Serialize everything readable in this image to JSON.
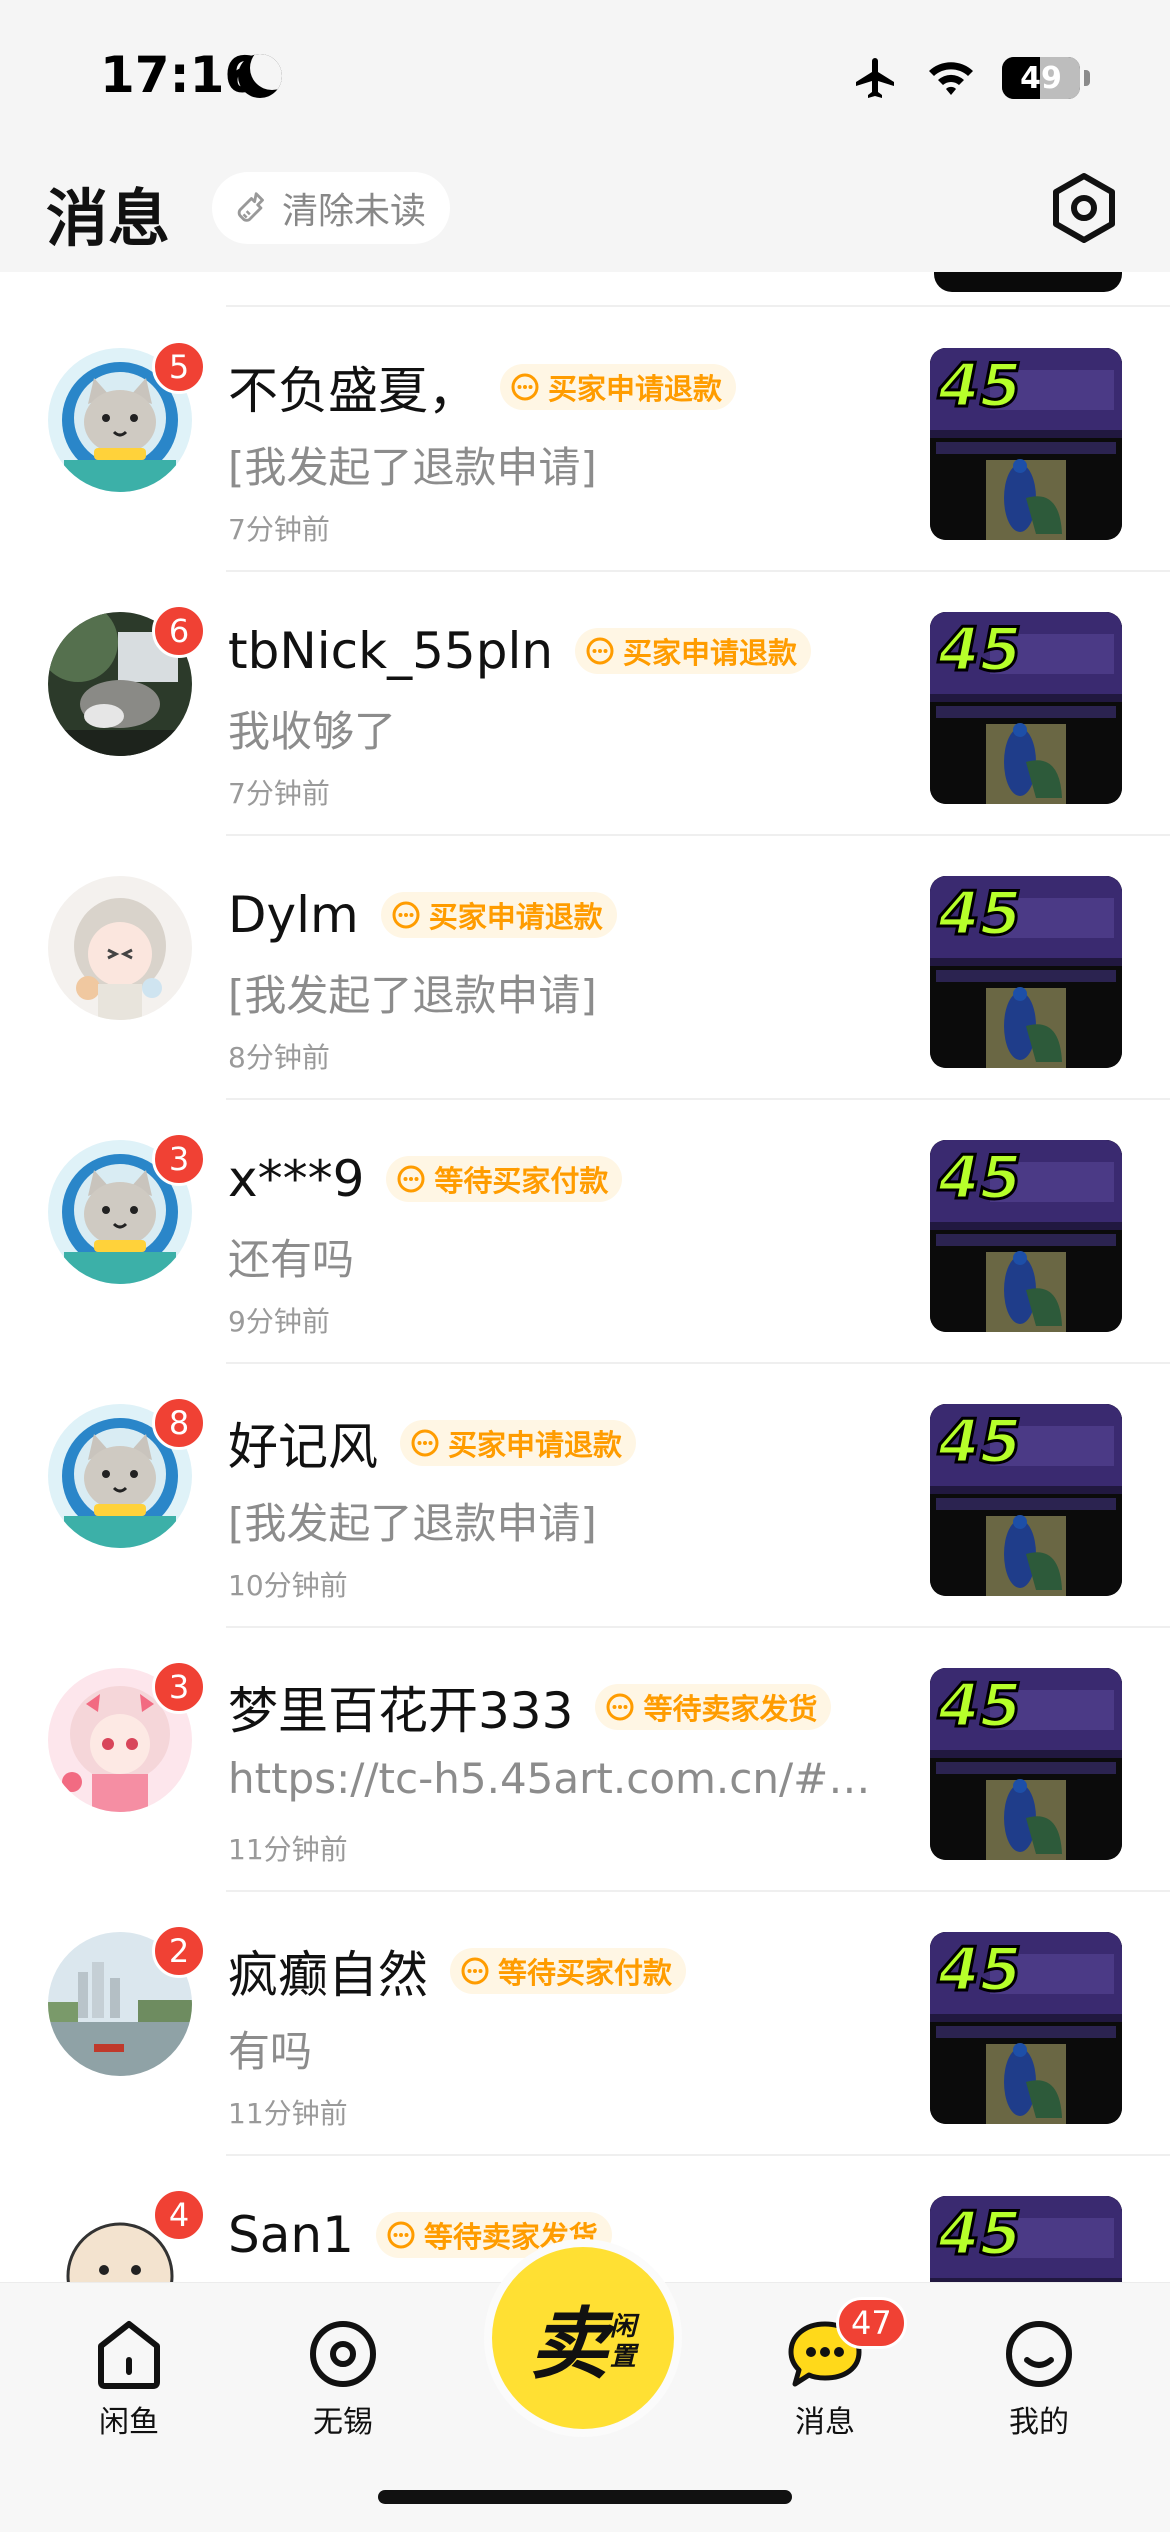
{
  "status_bar": {
    "time": "17:16",
    "battery": "49",
    "battery_level": 0.49
  },
  "header": {
    "title": "消息",
    "clear_unread_label": "清除未读"
  },
  "conversations": [
    {
      "name": "不负盛夏，",
      "badge": "5",
      "status": "买家申请退款",
      "message": "[我发起了退款申请]",
      "time": "7分钟前",
      "avatar": "cat-astronaut"
    },
    {
      "name": "tbNick_55pln",
      "badge": "6",
      "status": "买家申请退款",
      "message": "我收够了",
      "time": "7分钟前",
      "avatar": "photo-dark"
    },
    {
      "name": "Dylm",
      "badge": "",
      "status": "买家申请退款",
      "message": "[我发起了退款申请]",
      "time": "8分钟前",
      "avatar": "anime-girl-light"
    },
    {
      "name": "x***9",
      "badge": "3",
      "status": "等待买家付款",
      "message": "还有吗",
      "time": "9分钟前",
      "avatar": "cat-astronaut"
    },
    {
      "name": "好记风",
      "badge": "8",
      "status": "买家申请退款",
      "message": "[我发起了退款申请]",
      "time": "10分钟前",
      "avatar": "cat-astronaut"
    },
    {
      "name": "梦里百花开333",
      "badge": "3",
      "status": "等待卖家发货",
      "message": "https://tc-h5.45art.com.cn/#/...",
      "time": "11分钟前",
      "avatar": "anime-girl-pink"
    },
    {
      "name": "疯癫自然",
      "badge": "2",
      "status": "等待买家付款",
      "message": "有吗",
      "time": "11分钟前",
      "avatar": "city-landscape"
    },
    {
      "name": "San1",
      "badge": "4",
      "status": "等待卖家发货",
      "message": "",
      "time": "",
      "avatar": "cartoon-face"
    }
  ],
  "thumbnail": {
    "logo_text": "45"
  },
  "tab_bar": {
    "tabs": [
      {
        "label": "闲鱼",
        "icon": "home-icon"
      },
      {
        "label": "无锡",
        "icon": "location-icon"
      },
      {
        "label": "消息",
        "icon": "chat-icon"
      },
      {
        "label": "我的",
        "icon": "profile-icon"
      }
    ],
    "sell_main": "卖",
    "sell_sub_1": "闲",
    "sell_sub_2": "置",
    "message_badge": "47"
  },
  "colors": {
    "accent_yellow": "#ffe033",
    "status_orange": "#ff9c00",
    "badge_red": "#f04134"
  }
}
